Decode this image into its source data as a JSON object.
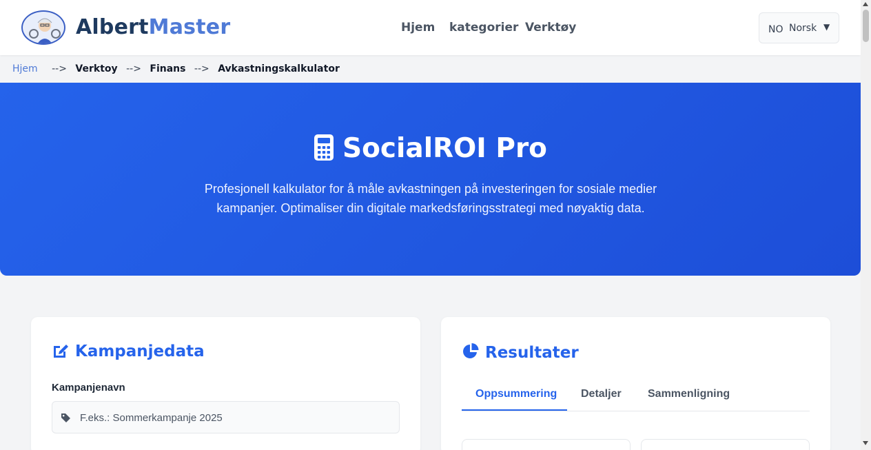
{
  "header": {
    "brand_part1": "Albert",
    "brand_part2": "Master",
    "nav": [
      {
        "label": "Hjem"
      },
      {
        "label": "kategorier"
      },
      {
        "label": "Verktøy"
      }
    ],
    "language": {
      "code": "NO",
      "name": "Norsk"
    }
  },
  "breadcrumb": {
    "home": "Hjem",
    "separator": "-->",
    "items": [
      "Verktoy",
      "Finans",
      "Avkastningskalkulator"
    ]
  },
  "hero": {
    "title": "SocialROI Pro",
    "description": "Profesjonell kalkulator for å måle avkastningen på investeringen for sosiale medier kampanjer. Optimaliser din digitale markedsføringsstrategi med nøyaktig data."
  },
  "campaign": {
    "title": "Kampanjedata",
    "name_label": "Kampanjenavn",
    "name_placeholder": "F.eks.: Sommerkampanje 2025",
    "name_value": ""
  },
  "results": {
    "title": "Resultater",
    "tabs": [
      {
        "label": "Oppsummering",
        "active": true
      },
      {
        "label": "Detaljer",
        "active": false
      },
      {
        "label": "Sammenligning",
        "active": false
      }
    ]
  },
  "colors": {
    "primary": "#2563eb",
    "brand_dark": "#1e3a5f",
    "brand_light": "#4f7ad6"
  },
  "icons": {
    "hero": "calculator-icon",
    "campaign": "edit-icon",
    "results": "pie-chart-icon",
    "field": "tag-icon"
  }
}
